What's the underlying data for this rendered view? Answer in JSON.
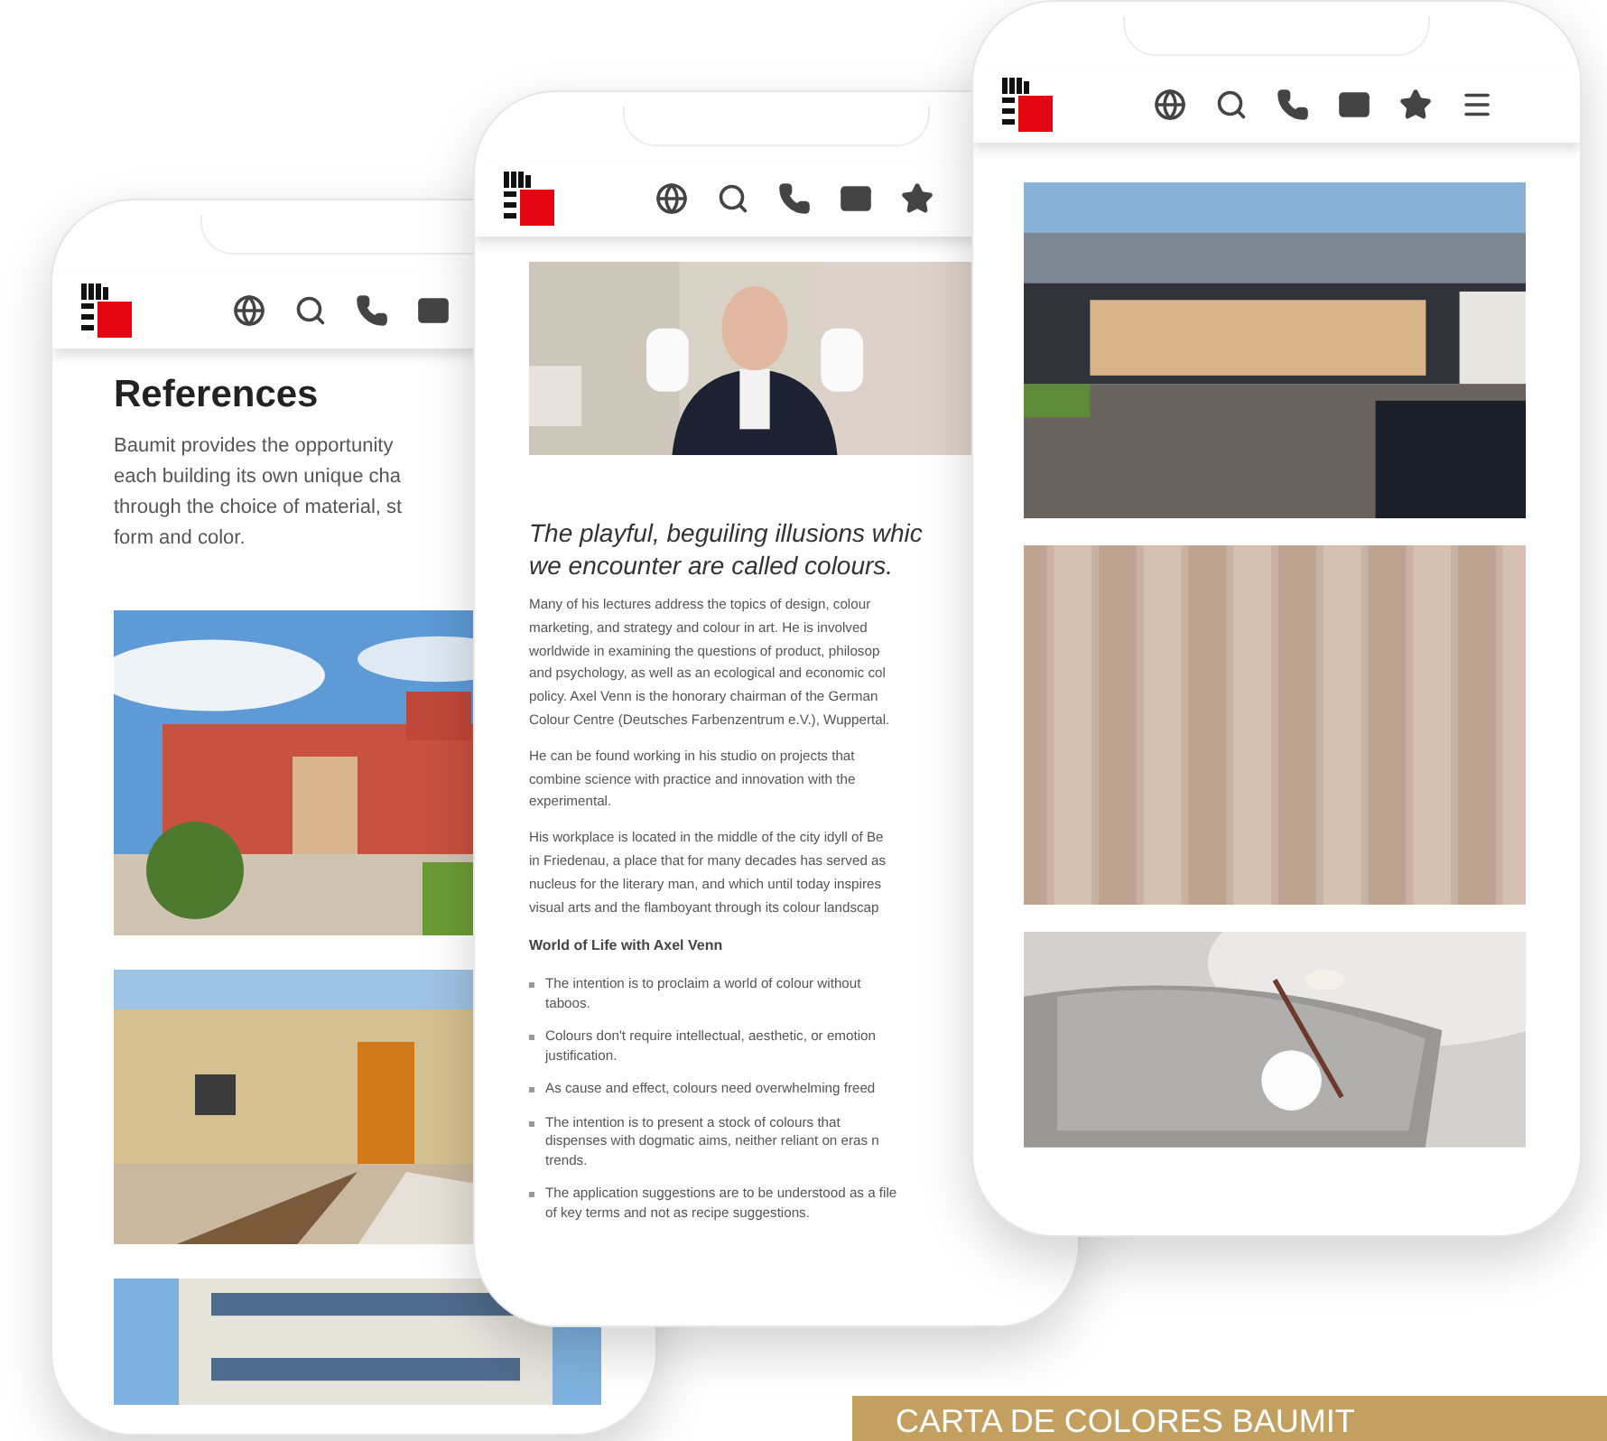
{
  "phone_left": {
    "title": "References",
    "intro": "Baumit provides the opportunity\neach building its own unique cha\nthrough the choice of material, st\nform and color."
  },
  "phone_middle": {
    "quote": "The playful, beguiling illusions whic\nwe encounter are called colours.",
    "paragraphs": [
      "Many of his lectures address the topics of design, colour\nmarketing, and strategy and colour in art. He is involved\nworldwide in examining the questions of product, philosop\nand psychology, as well as an ecological and economic col\npolicy. Axel Venn is the honorary chairman of the German\nColour Centre (Deutsches Farbenzentrum e.V.), Wuppertal.",
      "He can be found working in his studio on projects that\ncombine science with practice and innovation with the\nexperimental.",
      "His workplace is located in the middle of the city idyll of Be\nin Friedenau, a place that for many decades has served as\nnucleus for the literary man, and which until today inspires\nvisual arts and the flamboyant through its colour landscap"
    ],
    "subheading": "World of Life with Axel Venn",
    "bullets": [
      "The intention is to proclaim a world of colour without\ntaboos.",
      "Colours don't require intellectual, aesthetic, or emotion\njustification.",
      "As cause and effect, colours need overwhelming freed",
      "The intention is to present a stock of colours that\ndispenses with dogmatic aims, neither reliant on eras n\ntrends.",
      "The application suggestions are to be understood as a file\nof key terms and not as recipe suggestions."
    ]
  },
  "banner": {
    "text": "CARTA DE COLORES BAUMIT"
  }
}
